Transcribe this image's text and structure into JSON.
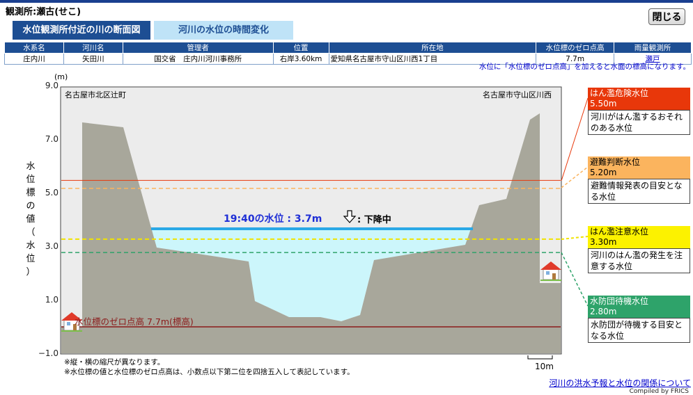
{
  "station": {
    "title": "観測所:瀬古(せこ)"
  },
  "close_label": "閉じる",
  "tabs": [
    {
      "label": "水位観測所付近の川の断面図"
    },
    {
      "label": "河川の水位の時間変化"
    }
  ],
  "info_table": {
    "headers": [
      "水系名",
      "河川名",
      "管理者",
      "位置",
      "所在地",
      "水位標のゼロ点高",
      "雨量観測所"
    ],
    "row": [
      "庄内川",
      "矢田川",
      "国交省　庄内川河川事務所",
      "右岸3.60km",
      "愛知県名古屋市守山区川西1丁目",
      "7.7m",
      "瀬戸"
    ]
  },
  "note_top": "水位に「水位標のゼロ点高」を加えると水面の標高になります。",
  "axis": {
    "unit": "(m)",
    "ticks": [
      "9.0",
      "7.0",
      "5.0",
      "3.0",
      "1.0",
      "−1.0"
    ],
    "ylabel": [
      "水",
      "位",
      "標",
      "の",
      "値",
      "（",
      "水",
      "位",
      "）"
    ]
  },
  "bank_labels": {
    "left": "名古屋市北区辻町",
    "right": "名古屋市守山区川西"
  },
  "current": {
    "time": "19:40の水位 : 3.7m",
    "trend": ": 下降中",
    "level": 3.7
  },
  "zero_point_label": "水位標のゼロ点高 7.7m(標高)",
  "levels": [
    {
      "name": "はん濫危険水位",
      "value_label": "5.50m",
      "value": 5.5,
      "desc": "河川がはん濫するおそれのある水位",
      "color": "#e8370a",
      "text_color": "#ffffff"
    },
    {
      "name": "避難判断水位",
      "value_label": "5.20m",
      "value": 5.2,
      "desc": "避難情報発表の目安となる水位",
      "color": "#fbb45e",
      "text_color": "#000000"
    },
    {
      "name": "はん濫注意水位",
      "value_label": "3.30m",
      "value": 3.3,
      "desc": "河川のはん濫の発生を注意する水位",
      "color": "#fcf200",
      "text_color": "#000000"
    },
    {
      "name": "水防団待機水位",
      "value_label": "2.80m",
      "value": 2.8,
      "desc": "水防団が待機する目安となる水位",
      "color": "#2ea36a",
      "text_color": "#ffffff"
    }
  ],
  "footnotes": [
    "※縦・横の縮尺が異なります。",
    "※水位標の値と水位標のゼロ点高は、小数点以下第二位を四捨五入して表記しています。"
  ],
  "scale_label": "10m",
  "flood_link": "河川の洪水予報と水位の関係について",
  "credit": "Compiled by FRICS",
  "colors": {
    "ground": "#a8a79b",
    "water_fill": "#ccf6fb",
    "water_line": "#2aa8e6",
    "zero_line": "#8b1a1a",
    "plot_bg": "#ececec"
  }
}
